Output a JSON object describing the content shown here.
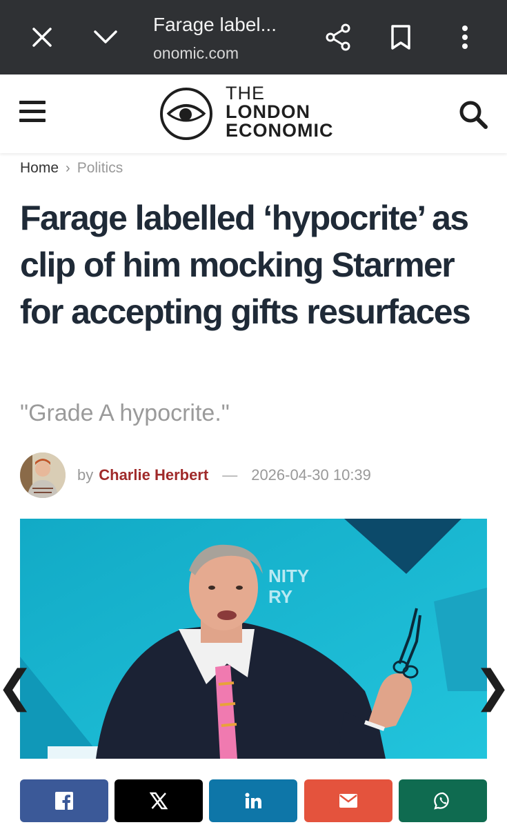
{
  "browser": {
    "title": "Farage label...",
    "url": "onomic.com",
    "icons": [
      "close-icon",
      "chevron-down-icon",
      "share-icon",
      "bookmark-icon",
      "more-vert-icon"
    ]
  },
  "site": {
    "logo_line1": "THE",
    "logo_line2": "LONDON",
    "logo_line3": "ECONOMIC"
  },
  "breadcrumb": {
    "home": "Home",
    "separator": "›",
    "current": "Politics"
  },
  "article": {
    "headline": "Farage labelled ‘hypocrite’ as clip of him mocking Starmer for accepting gifts resurfaces",
    "subtitle": "\"Grade A hypocrite.\"",
    "by": "by",
    "author": "Charlie Herbert",
    "dash": "—",
    "date": "2026-04-30 10:39",
    "image_caption_text_1": "NITY",
    "image_caption_text_2": "RY"
  },
  "gallery": {
    "prev": "❮",
    "next": "❯"
  },
  "share": [
    {
      "name": "facebook",
      "label": "f",
      "color": "#3b5998"
    },
    {
      "name": "x",
      "label": "X",
      "color": "#000000"
    },
    {
      "name": "linkedin",
      "label": "in",
      "color": "#0e76a8"
    },
    {
      "name": "email",
      "label": "✉",
      "color": "#e4533d"
    },
    {
      "name": "whatsapp",
      "label": "✆",
      "color": "#0f6b50"
    }
  ],
  "colors": {
    "browser_bar": "#2f3134",
    "headline": "#1f2a37",
    "author": "#a02a2a",
    "hero_bg": "#16b5cf"
  }
}
